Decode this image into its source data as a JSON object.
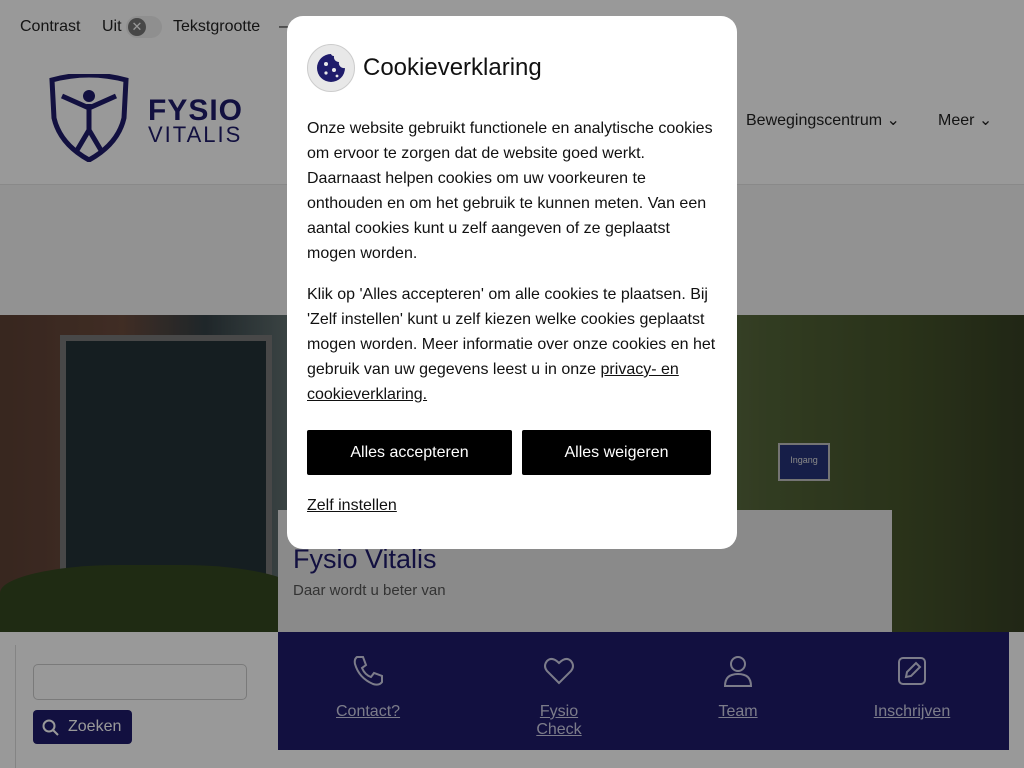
{
  "topbar": {
    "contrast_label": "Contrast",
    "contrast_state": "Uit",
    "textsize_label": "Tekstgrootte"
  },
  "logo": {
    "line1": "FYSIO",
    "line2": "VITALIS"
  },
  "nav": {
    "items": [
      {
        "label": "Bewegingscentrum"
      },
      {
        "label": "Meer"
      }
    ]
  },
  "hero": {
    "title": "Fysio Vitalis",
    "subtitle": "Daar wordt u beter van",
    "sign_text": "Ingang"
  },
  "search": {
    "button_label": "Zoeken",
    "placeholder": ""
  },
  "quicklinks": [
    {
      "label": "Contact?",
      "icon": "phone-icon"
    },
    {
      "label": "Fysio Check",
      "icon": "heart-icon"
    },
    {
      "label": "Team",
      "icon": "user-icon"
    },
    {
      "label": "Inschrijven",
      "icon": "edit-icon"
    }
  ],
  "cookie": {
    "title": "Cookieverklaring",
    "p1": "Onze website gebruikt functionele en analytische cookies om ervoor te zorgen dat de website goed werkt. Daarnaast helpen cookies om uw voorkeuren te onthouden en om het gebruik te kunnen meten. Van een aantal cookies kunt u zelf aangeven of ze geplaatst mogen worden.",
    "p2_text": "Klik op 'Alles accepteren' om alle cookies te plaatsen. Bij 'Zelf instellen' kunt u zelf kiezen welke cookies geplaatst mogen worden. Meer informatie over onze cookies en het gebruik van uw gegevens leest u in onze ",
    "p2_link": "privacy- en cookieverklaring.",
    "accept_label": "Alles accepteren",
    "reject_label": "Alles weigeren",
    "custom_label": "Zelf instellen"
  },
  "colors": {
    "brand": "#1f1c6b",
    "button": "#000000"
  }
}
